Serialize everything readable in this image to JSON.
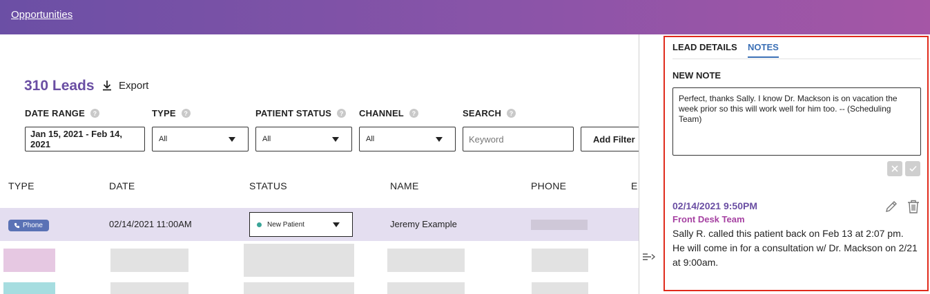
{
  "header": {
    "breadcrumb": "Opportunities"
  },
  "summary": {
    "leads_count": "310 Leads",
    "export_label": "Export"
  },
  "filters": {
    "date_range": {
      "label": "DATE RANGE",
      "value": "Jan 15, 2021 - Feb 14, 2021"
    },
    "type": {
      "label": "TYPE",
      "value": "All"
    },
    "patient_status": {
      "label": "PATIENT STATUS",
      "value": "All"
    },
    "channel": {
      "label": "CHANNEL",
      "value": "All"
    },
    "search": {
      "label": "SEARCH",
      "placeholder": "Keyword"
    },
    "add_filter_label": "Add Filter",
    "help_glyph": "?"
  },
  "table": {
    "columns": [
      "TYPE",
      "DATE",
      "STATUS",
      "NAME",
      "PHONE",
      "E"
    ],
    "selected_row": {
      "type_badge": "Phone",
      "date": "02/14/2021 11:00AM",
      "status": "New Patient",
      "name": "Jeremy Example"
    }
  },
  "panel": {
    "tabs": [
      "LEAD DETAILS",
      "NOTES"
    ],
    "active_tab": "NOTES",
    "new_note_heading": "NEW NOTE",
    "new_note_text": "Perfect, thanks Sally. I know Dr. Mackson is on vacation the week prior so this will work well for him too. -- (Scheduling Team)",
    "note_entry": {
      "timestamp": "02/14/2021 9:50PM",
      "author": "Front Desk Team",
      "body": "Sally R. called this patient back on Feb 13 at 2:07 pm. He will come in for a consultation w/ Dr. Mackson on 2/21 at 9:00am."
    }
  },
  "icons": {
    "export": "download-icon",
    "phone": "phone-icon",
    "collapse": "collapse-panel-icon",
    "cancel": "close-icon",
    "confirm": "check-icon",
    "edit": "pencil-icon",
    "delete": "trash-icon"
  },
  "colors": {
    "brand_purple": "#6a4ea3",
    "author_magenta": "#a540a1",
    "active_tab_blue": "#3a6fb5",
    "highlight_border": "#e02a1b",
    "selected_row_bg": "#e4def0",
    "status_new_patient": "#3aa598"
  }
}
